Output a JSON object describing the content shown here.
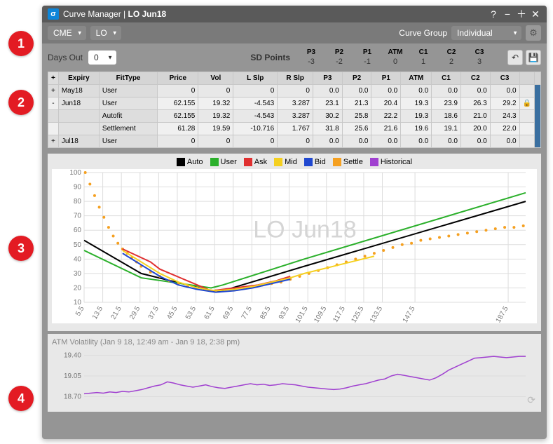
{
  "title_prefix": "Curve Manager | ",
  "title_symbol": "LO Jun18",
  "titlebar_icon": "σ",
  "toolbar": {
    "exchange": "CME",
    "product": "LO",
    "curve_group_label": "Curve Group",
    "curve_group_value": "Individual"
  },
  "sd_row": {
    "days_out_label": "Days Out",
    "days_out_value": "0",
    "sd_points_label": "SD Points",
    "cols": [
      {
        "h": "P3",
        "v": "-3"
      },
      {
        "h": "P2",
        "v": "-2"
      },
      {
        "h": "P1",
        "v": "-1"
      },
      {
        "h": "ATM",
        "v": "0"
      },
      {
        "h": "C1",
        "v": "1"
      },
      {
        "h": "C2",
        "v": "2"
      },
      {
        "h": "C3",
        "v": "3"
      }
    ]
  },
  "grid_headers": [
    "Expiry",
    "FitType",
    "Price",
    "Vol",
    "L Slp",
    "R Slp",
    "P3",
    "P2",
    "P1",
    "ATM",
    "C1",
    "C2",
    "C3"
  ],
  "grid_rows": [
    {
      "exp": "+",
      "expiry": "May18",
      "fit": "User",
      "vals": [
        "0",
        "0",
        "0",
        "0",
        "0.0",
        "0.0",
        "0.0",
        "0.0",
        "0.0",
        "0.0",
        "0.0"
      ],
      "lock": ""
    },
    {
      "exp": "-",
      "expiry": "Jun18",
      "fit": "User",
      "vals": [
        "62.155",
        "19.32",
        "-4.543",
        "3.287",
        "23.1",
        "21.3",
        "20.4",
        "19.3",
        "23.9",
        "26.3",
        "29.2"
      ],
      "lock": "🔒"
    },
    {
      "exp": "",
      "expiry": "",
      "fit": "Autofit",
      "vals": [
        "62.155",
        "19.32",
        "-4.543",
        "3.287",
        "30.2",
        "25.8",
        "22.2",
        "19.3",
        "18.6",
        "21.0",
        "24.3"
      ],
      "lock": ""
    },
    {
      "exp": "",
      "expiry": "",
      "fit": "Settlement",
      "vals": [
        "61.28",
        "19.59",
        "-10.716",
        "1.767",
        "31.8",
        "25.6",
        "21.6",
        "19.6",
        "19.1",
        "20.0",
        "22.0"
      ],
      "lock": ""
    },
    {
      "exp": "+",
      "expiry": "Jul18",
      "fit": "User",
      "vals": [
        "0",
        "0",
        "0",
        "0",
        "0.0",
        "0.0",
        "0.0",
        "0.0",
        "0.0",
        "0.0",
        "0.0"
      ],
      "lock": ""
    }
  ],
  "legend": [
    {
      "name": "Auto",
      "color": "#000000"
    },
    {
      "name": "User",
      "color": "#2bb02b"
    },
    {
      "name": "Ask",
      "color": "#e03030"
    },
    {
      "name": "Mid",
      "color": "#f5d020"
    },
    {
      "name": "Bid",
      "color": "#2048d0"
    },
    {
      "name": "Settle",
      "color": "#f5a020"
    },
    {
      "name": "Historical",
      "color": "#a040d0"
    }
  ],
  "chart_data": {
    "type": "line",
    "title": "LO Jun18",
    "xlabel": "",
    "ylabel": "",
    "x_ticks": [
      5.5,
      13.5,
      21.5,
      29.5,
      37.5,
      45.5,
      53.5,
      61.5,
      69.5,
      77.5,
      85.5,
      93.5,
      101.5,
      109.5,
      117.5,
      125.5,
      133.5,
      147.5,
      187.5
    ],
    "y_ticks": [
      10,
      20,
      30,
      40,
      50,
      60,
      70,
      80,
      90,
      100
    ],
    "ylim": [
      10,
      100
    ],
    "xlim": [
      5.5,
      195
    ],
    "series": [
      {
        "name": "Auto",
        "color": "#000000",
        "x": [
          5.5,
          30,
          60,
          65,
          100,
          195
        ],
        "y": [
          53,
          30,
          18,
          18,
          35,
          80
        ]
      },
      {
        "name": "User",
        "color": "#2bb02b",
        "x": [
          5.5,
          30,
          60,
          65,
          100,
          195
        ],
        "y": [
          46,
          27,
          20,
          22,
          40,
          86
        ]
      },
      {
        "name": "Settle",
        "color": "#f5a020",
        "type": "scatter",
        "x": [
          6,
          8,
          10,
          12,
          14,
          16,
          18,
          20,
          22,
          24,
          26,
          28,
          30,
          34,
          38,
          42,
          46,
          50,
          54,
          58,
          62,
          66,
          70,
          74,
          78,
          82,
          86,
          90,
          94,
          98,
          102,
          106,
          110,
          114,
          118,
          122,
          126,
          130,
          134,
          138,
          142,
          146,
          150,
          154,
          158,
          162,
          166,
          170,
          174,
          178,
          182,
          186,
          190,
          194
        ],
        "y": [
          100,
          92,
          84,
          76,
          69,
          62,
          56,
          51,
          47,
          44,
          41,
          38,
          35,
          31,
          28,
          25,
          23,
          21,
          20,
          19,
          18,
          18,
          19,
          20,
          21,
          22,
          23,
          24,
          26,
          28,
          30,
          32,
          34,
          36,
          38,
          40,
          42,
          44,
          46,
          48,
          50,
          51,
          53,
          54,
          55,
          56,
          57,
          58,
          59,
          60,
          61,
          62,
          62,
          63
        ]
      },
      {
        "name": "Ask",
        "color": "#e03030",
        "x": [
          22,
          26,
          30,
          34,
          38,
          60,
          80,
          88,
          94
        ],
        "y": [
          47,
          44,
          41,
          38,
          33,
          18,
          22,
          25,
          28
        ]
      },
      {
        "name": "Mid",
        "color": "#f5d020",
        "x": [
          22,
          30,
          38,
          46,
          54,
          62,
          70,
          78,
          86,
          94,
          100,
          110,
          120,
          130
        ],
        "y": [
          46,
          38,
          30,
          24,
          20,
          18,
          19,
          21,
          24,
          27,
          30,
          34,
          38,
          42
        ]
      },
      {
        "name": "Bid",
        "color": "#2048d0",
        "x": [
          22,
          30,
          38,
          46,
          54,
          62,
          70,
          78,
          86,
          94
        ],
        "y": [
          44,
          36,
          28,
          22,
          19,
          17,
          18,
          20,
          23,
          26
        ]
      }
    ]
  },
  "vol_panel": {
    "title": "ATM Volatility (Jan 9 18, 12:49 am - Jan 9 18, 2:38 pm)",
    "y_ticks": [
      "19.40",
      "19.05",
      "18.70"
    ],
    "color": "#a040d0",
    "series": {
      "ylim": [
        18.6,
        19.5
      ],
      "pts": [
        18.75,
        18.76,
        18.77,
        18.76,
        18.78,
        18.77,
        18.79,
        18.78,
        18.8,
        18.82,
        18.85,
        18.88,
        18.9,
        18.95,
        18.93,
        18.9,
        18.88,
        18.86,
        18.88,
        18.9,
        18.87,
        18.85,
        18.84,
        18.86,
        18.88,
        18.9,
        18.92,
        18.9,
        18.91,
        18.89,
        18.9,
        18.92,
        18.91,
        18.9,
        18.88,
        18.86,
        18.85,
        18.84,
        18.83,
        18.82,
        18.83,
        18.85,
        18.88,
        18.9,
        18.92,
        18.95,
        18.98,
        19.0,
        19.05,
        19.08,
        19.06,
        19.04,
        19.02,
        19.0,
        18.98,
        19.02,
        19.08,
        19.15,
        19.2,
        19.25,
        19.3,
        19.35,
        19.36,
        19.37,
        19.38,
        19.37,
        19.36,
        19.37,
        19.38,
        19.38
      ]
    }
  },
  "callouts": [
    "1",
    "2",
    "3",
    "4"
  ]
}
